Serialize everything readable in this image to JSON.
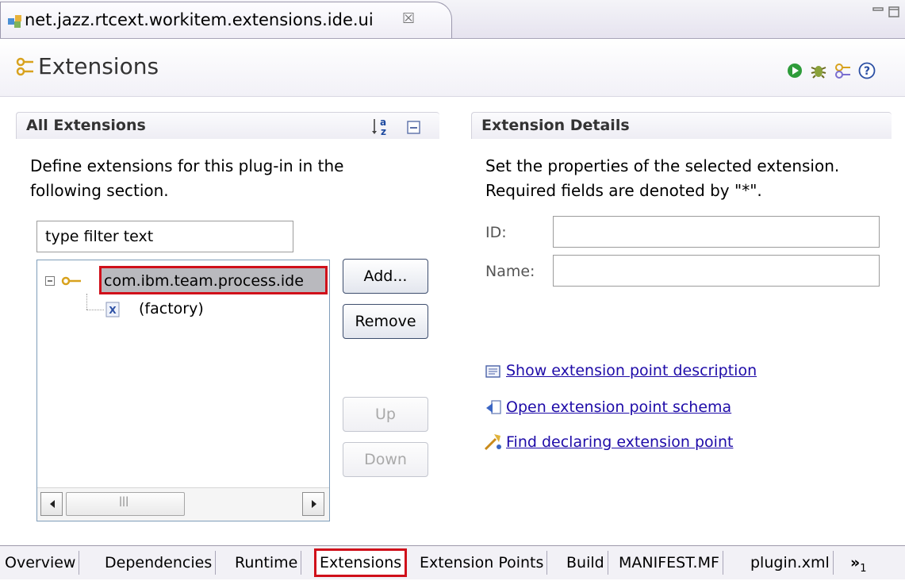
{
  "editor_tab": {
    "title": "net.jazz.rtcext.workitem.extensions.ide.ui",
    "close_glyph": "☒"
  },
  "header": {
    "title": "Extensions"
  },
  "all_extensions": {
    "title": "All Extensions",
    "description_line1": "Define extensions for this plug-in in the",
    "description_line2": "following section.",
    "filter_placeholder": "type filter text",
    "tree": {
      "root_label": "com.ibm.team.process.ide",
      "child_label": "(factory)"
    },
    "buttons": {
      "add": "Add...",
      "remove": "Remove",
      "up": "Up",
      "down": "Down"
    }
  },
  "extension_details": {
    "title": "Extension Details",
    "description_line1": "Set the properties of the selected extension.",
    "description_line2": "Required fields are denoted by \"*\".",
    "id_label": "ID:",
    "id_value": "",
    "name_label": "Name:",
    "name_value": "",
    "links": {
      "show_description": "Show extension point description",
      "open_schema": "Open extension point schema",
      "find_declaring": "Find declaring extension point"
    }
  },
  "bottom_tabs": [
    "Overview",
    "Dependencies",
    "Runtime",
    "Extensions",
    "Extension Points",
    "Build",
    "MANIFEST.MF",
    "plugin.xml"
  ],
  "bottom_tabs_more": "»",
  "bottom_tabs_more_count": "1",
  "selected_bottom_tab": "Extensions",
  "colors": {
    "highlight_border": "#d0101a",
    "link": "#1e0ba8",
    "tree_selection": "#b9b9be"
  }
}
